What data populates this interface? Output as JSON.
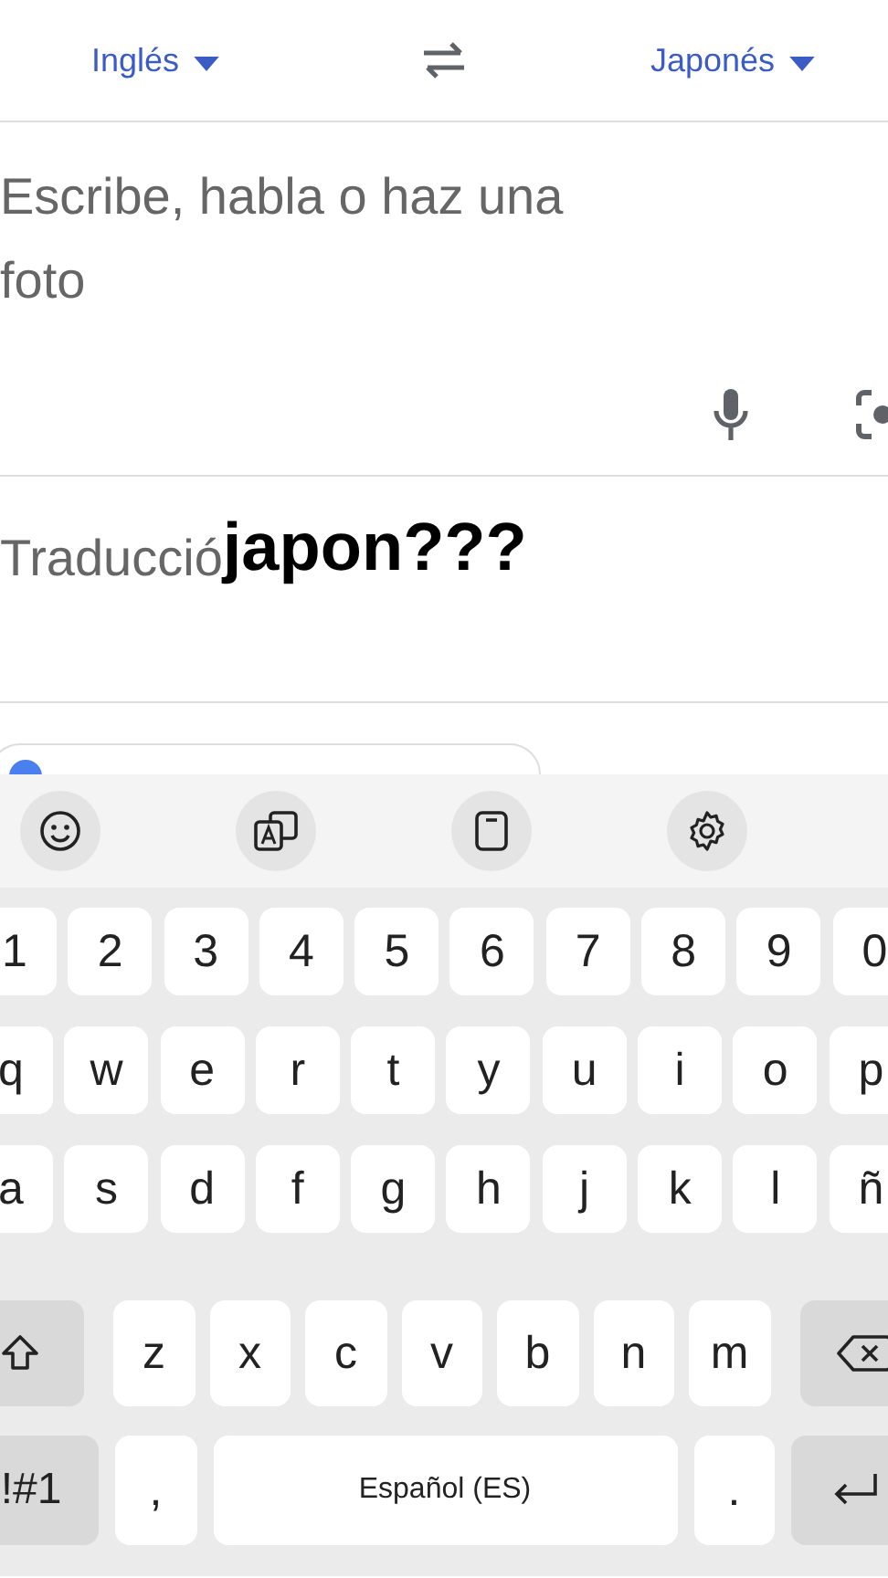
{
  "languages": {
    "source": "Inglés",
    "target": "Japonés"
  },
  "input": {
    "placeholder": "Escribe, habla o haz una foto"
  },
  "translation": {
    "placeholder": "Traducció"
  },
  "overlay_caption": "japon???",
  "keyboard": {
    "rows": [
      [
        "1",
        "2",
        "3",
        "4",
        "5",
        "6",
        "7",
        "8",
        "9",
        "0"
      ],
      [
        "q",
        "w",
        "e",
        "r",
        "t",
        "y",
        "u",
        "i",
        "o",
        "p"
      ],
      [
        "a",
        "s",
        "d",
        "f",
        "g",
        "h",
        "j",
        "k",
        "l",
        "ñ"
      ]
    ],
    "shift_row": {
      "letters": [
        "z",
        "x",
        "c",
        "v",
        "b",
        "n",
        "m"
      ]
    },
    "bottom_row": {
      "symbols": "!#1",
      "comma": ",",
      "space": "Español (ES)",
      "period": "."
    }
  }
}
